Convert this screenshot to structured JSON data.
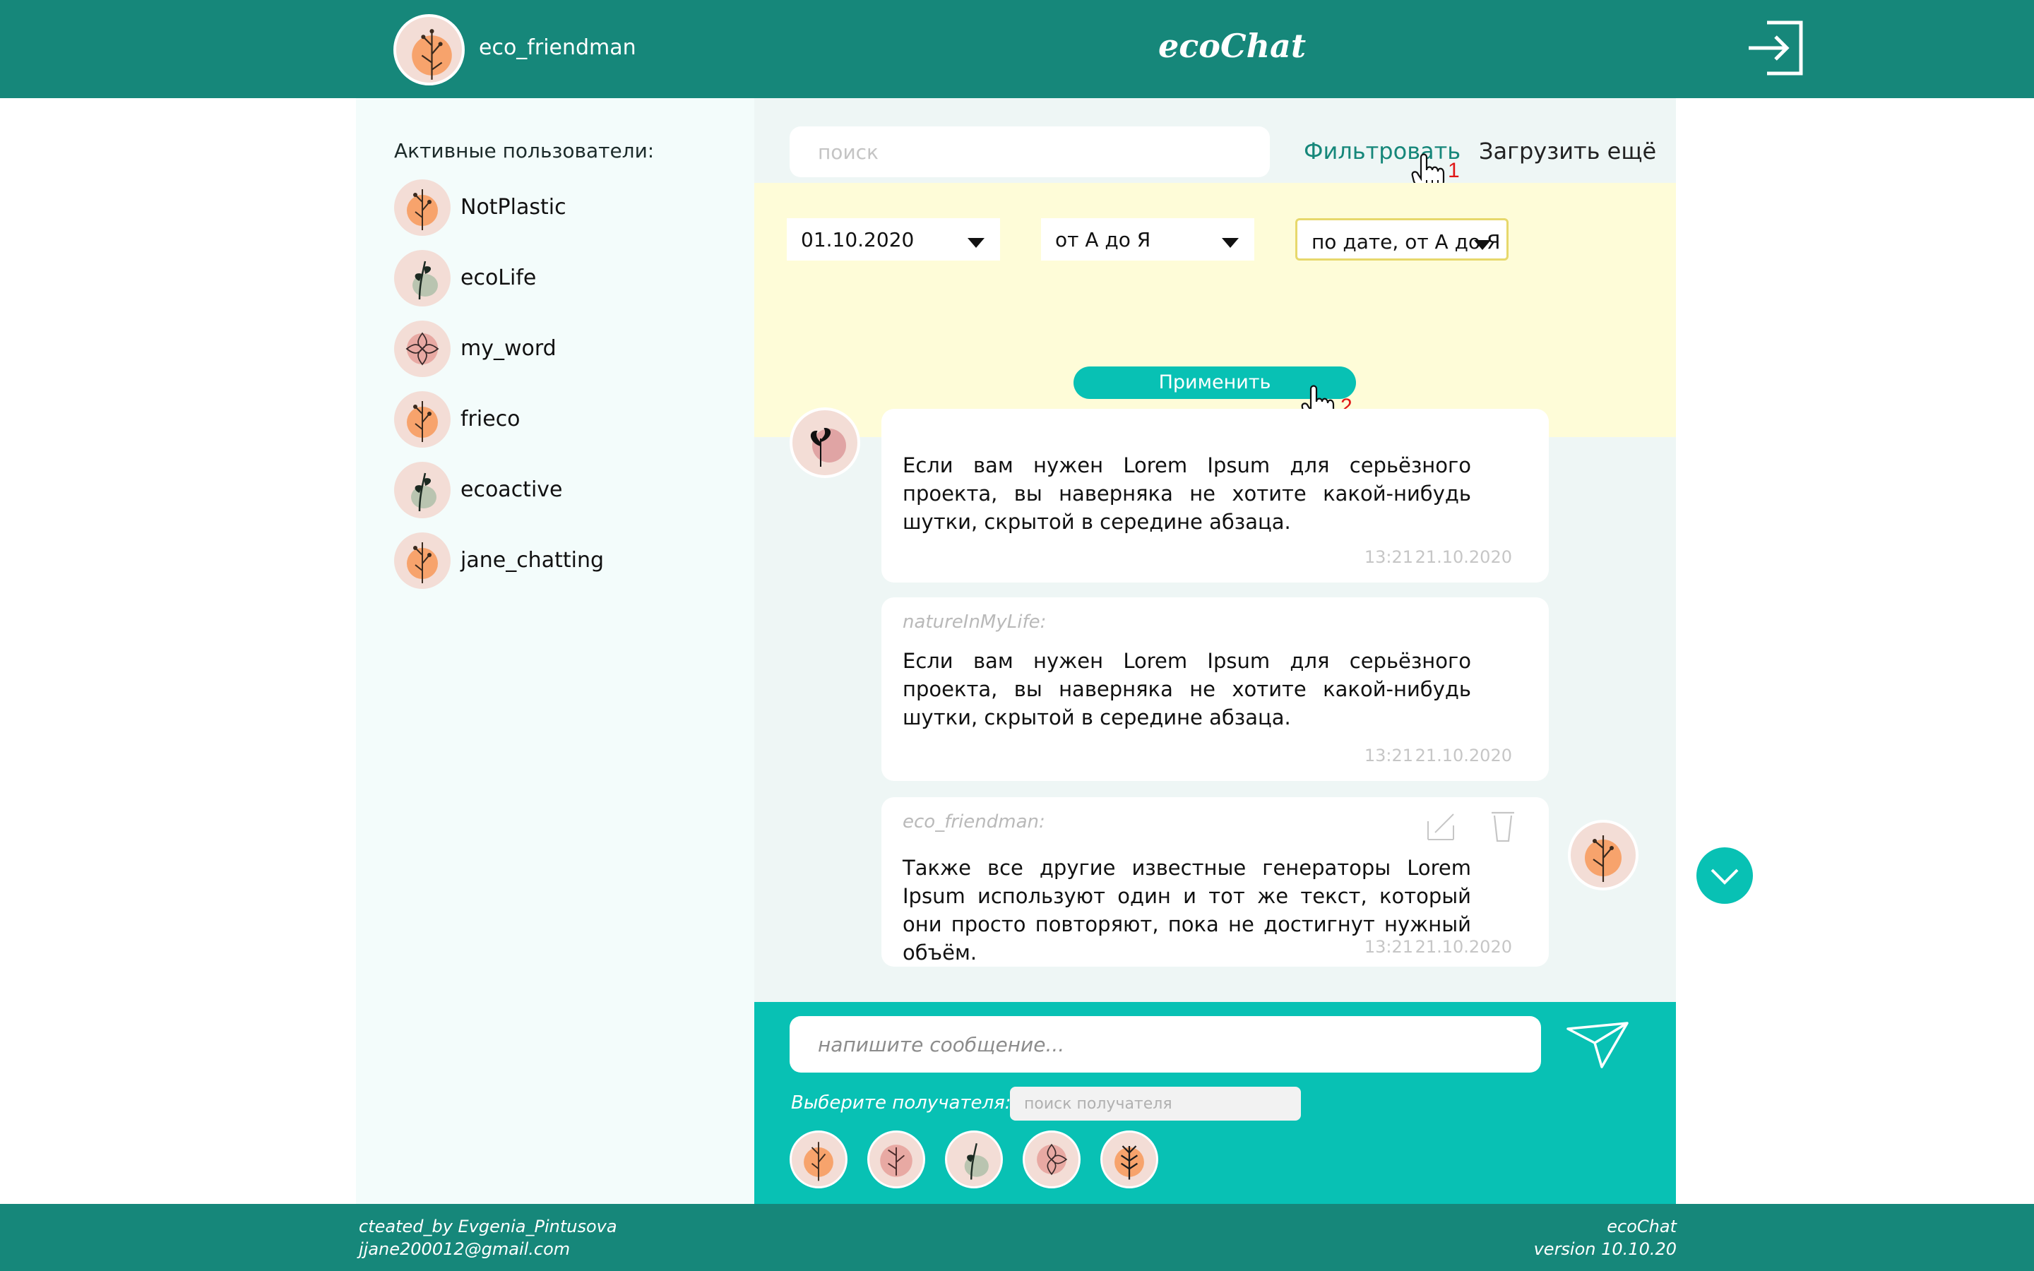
{
  "header": {
    "username": "eco_friendman",
    "app_title": "ecoChat",
    "logout_icon": "logout-icon"
  },
  "sidebar": {
    "title": "Активные пользователи:",
    "users": [
      {
        "name": "NotPlastic",
        "avatar": "orange-flower-avatar"
      },
      {
        "name": "ecoLife",
        "avatar": "green-leaf-avatar"
      },
      {
        "name": "my_word",
        "avatar": "pink-flower-avatar"
      },
      {
        "name": "frieco",
        "avatar": "orange-flower-avatar"
      },
      {
        "name": "ecoactive",
        "avatar": "green-leaf-avatar"
      },
      {
        "name": "jane_chatting",
        "avatar": "orange-flower-avatar"
      }
    ]
  },
  "chat": {
    "search_placeholder": "поиск",
    "filter_label": "Фильтровать",
    "load_more_label": "Загрузить ещё",
    "filter_panel": {
      "date_value": "01.10.2020",
      "sort_value": "от А до Я",
      "order_value": "по дате, от А до Я",
      "apply_label": "Применить"
    },
    "markers": {
      "one": "1",
      "two": "2"
    },
    "messages": [
      {
        "author": "",
        "text": "Если вам нужен Lorem Ipsum для серьёзного проекта, вы наверняка не хотите какой-нибудь шутки, скрытой в середине абзаца.",
        "time": "13:21",
        "date": "21.10.2020"
      },
      {
        "author": "natureInMyLife:",
        "text": "Если вам нужен Lorem Ipsum для серьёзного проекта, вы наверняка не хотите какой-нибудь шутки, скрытой в середине абзаца.",
        "time": "13:21",
        "date": "21.10.2020"
      },
      {
        "author": "eco_friendman:",
        "text": "Также все другие известные генераторы Lorem Ipsum используют один и тот же текст, который они просто повторяют, пока не достигнут нужный объём.",
        "time": "13:21",
        "date": "21.10.2020"
      }
    ]
  },
  "composer": {
    "message_placeholder": "напишите сообщение...",
    "recipient_label": "Выберите получателя:",
    "recipient_search_placeholder": "поиск получателя",
    "send_icon": "send-icon"
  },
  "footer": {
    "author": "cteated_by Evgenia_Pintusova",
    "email": "jjane200012@gmail.com",
    "app_name": "ecoChat",
    "version": "version 10.10.20"
  },
  "colors": {
    "header": "#16877a",
    "accent": "#08c1b4",
    "filter_panel": "#fefcd8",
    "avatar_bg": "#f3ddd6",
    "marker": "#e01616"
  }
}
